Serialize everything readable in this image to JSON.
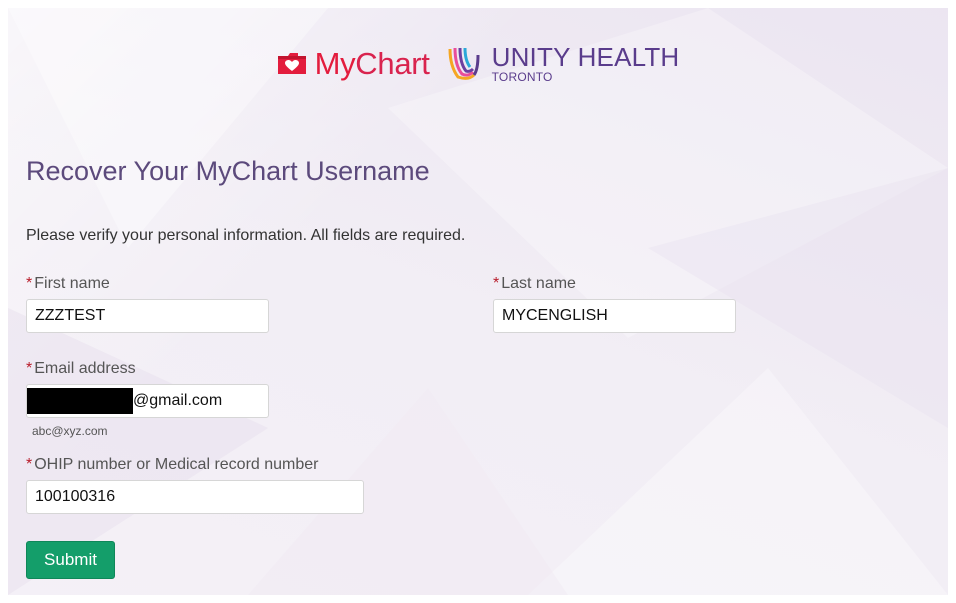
{
  "header": {
    "mychart_logo_prefix": "My",
    "mychart_logo_suffix": "Chart",
    "org_name_main": "UNITY HEALTH",
    "org_name_sub": "TORONTO"
  },
  "form": {
    "title": "Recover Your MyChart Username",
    "intro": "Please verify your personal information. All fields are required.",
    "required_marker": "*",
    "first_name": {
      "label": "First name",
      "value": "ZZZTEST"
    },
    "last_name": {
      "label": "Last name",
      "value": "MYCENGLISH"
    },
    "email": {
      "label": "Email address",
      "value": "@gmail.com",
      "hint": "abc@xyz.com"
    },
    "ohip": {
      "label": "OHIP number or Medical record number",
      "value": "100100316"
    },
    "submit_label": "Submit"
  },
  "colors": {
    "accent_green": "#149e6a",
    "title_purple": "#5c4a7c",
    "required_red": "#b81c2a",
    "mychart_red": "#e31c3d",
    "unity_purple": "#5a3c8c"
  },
  "icons": {
    "mychart": "mychart-folder-heart-icon",
    "unity": "unity-health-ribbon-icon"
  }
}
